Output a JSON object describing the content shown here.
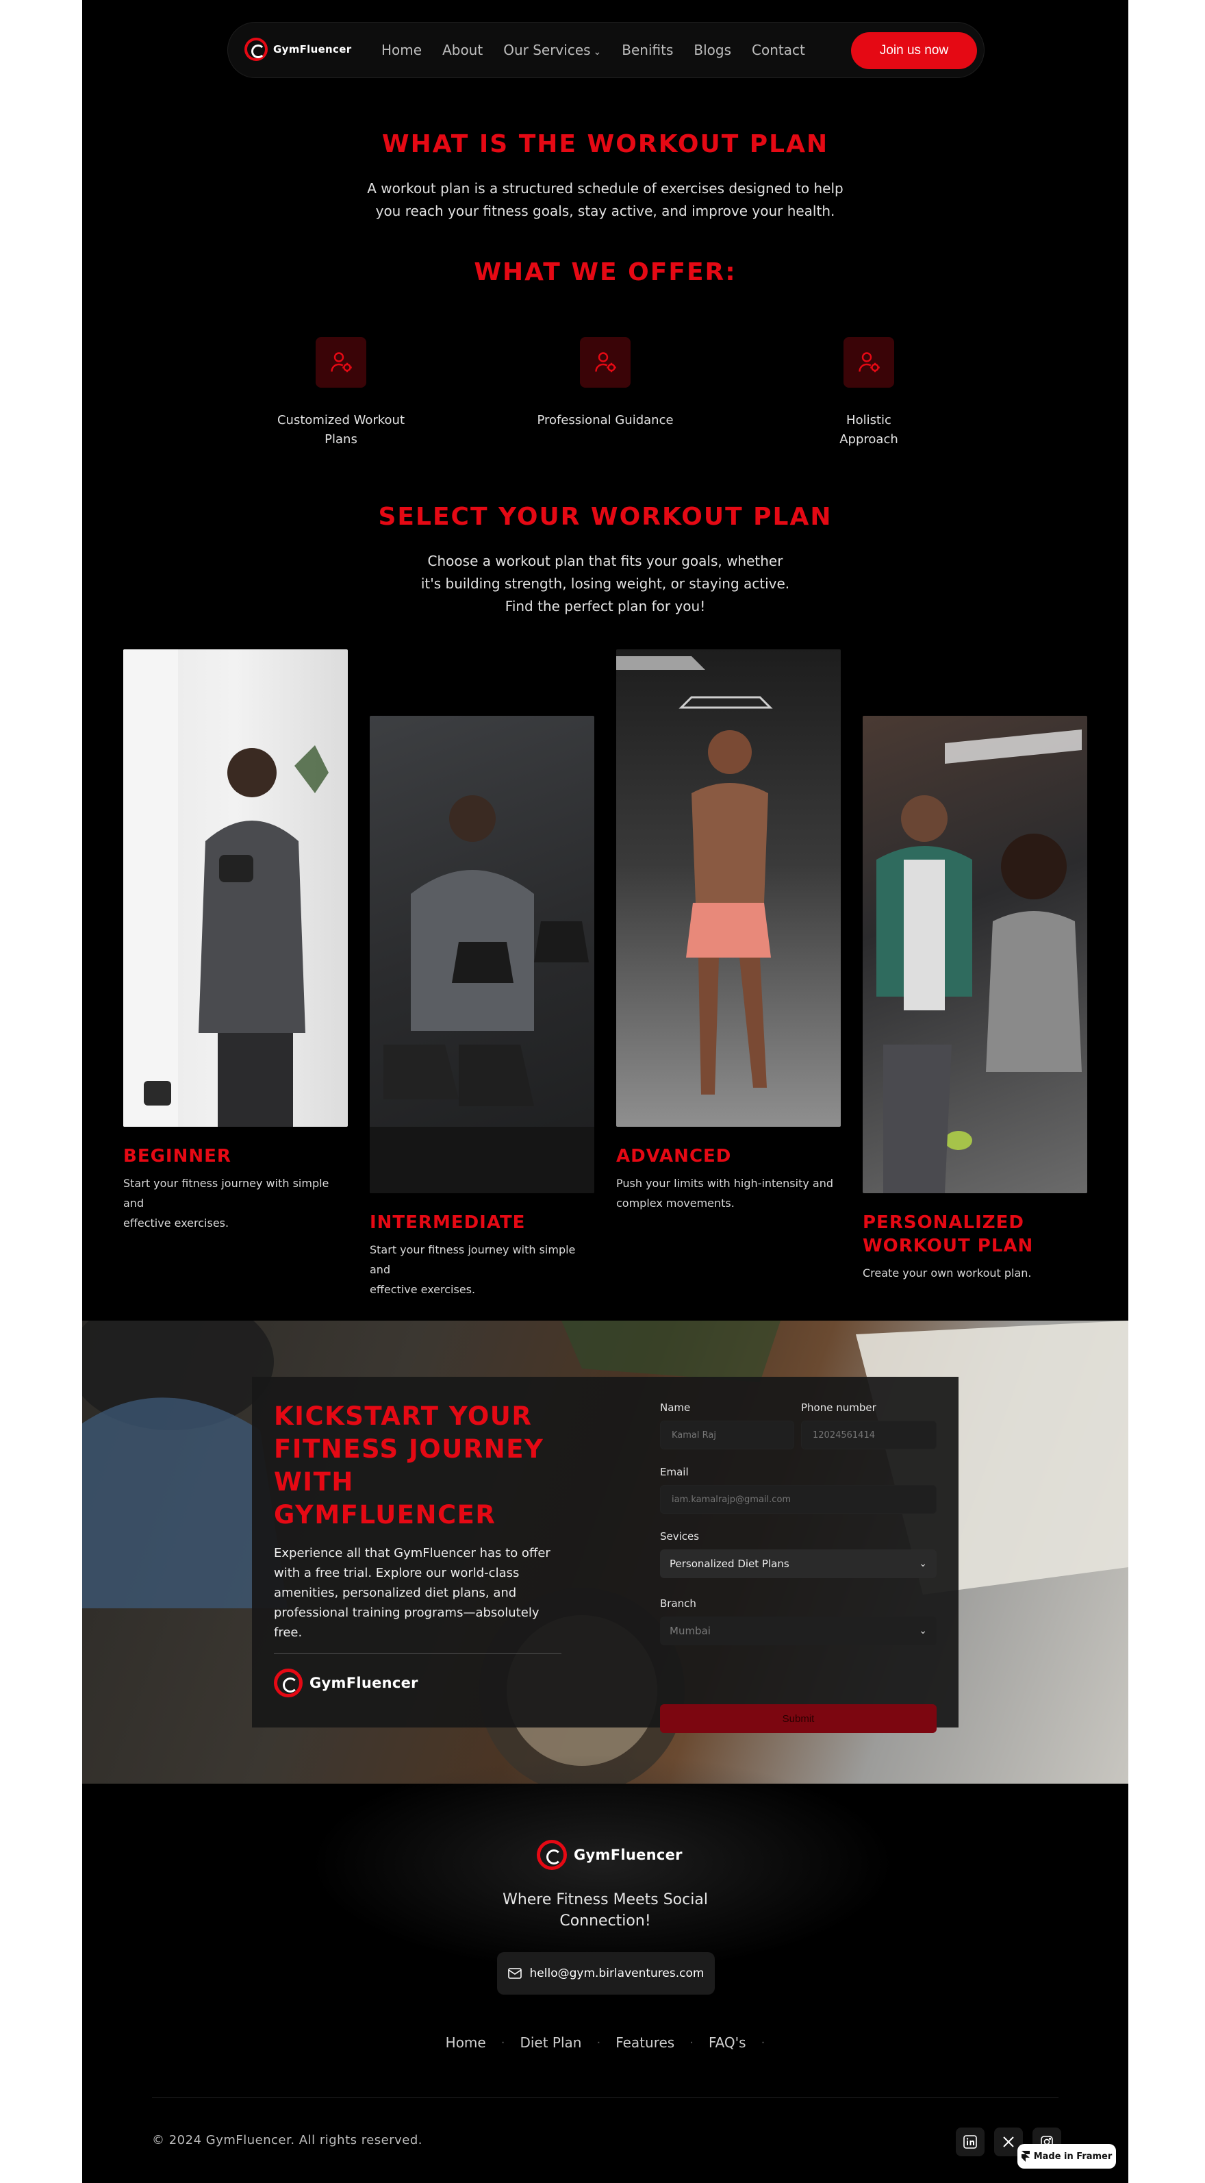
{
  "nav": {
    "brand": "GymFluencer",
    "links": [
      "Home",
      "About",
      "Our Services",
      "Benifits",
      "Blogs",
      "Contact"
    ],
    "join_label": "Join us now"
  },
  "workout": {
    "title": "WHAT IS THE WORKOUT PLAN",
    "description_line1": "A workout plan is a structured schedule of exercises designed to help",
    "description_line2": "you reach your fitness goals, stay active, and improve your health."
  },
  "offer": {
    "title": "WHAT WE OFFER:",
    "items": [
      {
        "label_line1": "Customized Workout",
        "label_line2": "Plans",
        "icon": "user-gear-icon"
      },
      {
        "label_line1": "Professional Guidance",
        "label_line2": "",
        "icon": "user-gear-icon"
      },
      {
        "label_line1": "Holistic",
        "label_line2": "Approach",
        "icon": "user-gear-icon"
      }
    ]
  },
  "select": {
    "title": "SELECT YOUR WORKOUT PLAN",
    "line1": "Choose a workout plan that fits your goals, whether",
    "line2": "it's building strength, losing weight, or staying active.",
    "line3": "Find the perfect plan for you!"
  },
  "plans": [
    {
      "title_line1": "BEGINNER",
      "title_line2": "",
      "desc_line1": "Start your fitness journey with simple and",
      "desc_line2": "effective exercises."
    },
    {
      "title_line1": "INTERMEDIATE",
      "title_line2": "",
      "desc_line1": "Start your fitness journey with simple and",
      "desc_line2": "effective exercises."
    },
    {
      "title_line1": "ADVANCED",
      "title_line2": "",
      "desc_line1": "Push your limits with high-intensity and",
      "desc_line2": "complex movements."
    },
    {
      "title_line1": "PERSONALIZED",
      "title_line2": "WORKOUT PLAN",
      "desc_line1": "Create your own workout plan.",
      "desc_line2": ""
    }
  ],
  "kickstart": {
    "title_line1": "KICKSTART YOUR",
    "title_line2": "FITNESS JOURNEY",
    "title_line3": "WITH",
    "title_line4": "GYMFLUENCER",
    "text_line1": "Experience all that GymFluencer has to offer",
    "text_line2": "with a free trial. Explore our world-class",
    "text_line3": "amenities, personalized diet plans, and",
    "text_line4": "professional training programs—absolutely",
    "text_line5": "free.",
    "brand": "GymFluencer"
  },
  "form": {
    "name_label": "Name",
    "name_placeholder": "Kamal Raj",
    "phone_label": "Phone number",
    "phone_placeholder": "12024561414",
    "email_label": "Email",
    "email_placeholder": "iam.kamalrajp@gmail.com",
    "services_label": "Sevices",
    "services_value": "Personalized Diet Plans",
    "branch_label": "Branch",
    "branch_value": "Mumbai",
    "submit_label": "Submit"
  },
  "footer": {
    "brand": "GymFluencer",
    "tagline_line1": "Where Fitness Meets Social",
    "tagline_line2": "Connection!",
    "email": "hello@gym.birlaventures.com",
    "links": [
      "Home",
      "Diet Plan",
      "Features",
      "FAQ's"
    ],
    "copyright": "© 2024 GymFluencer. All rights reserved.",
    "socials": [
      "linkedin-icon",
      "x-icon",
      "instagram-icon"
    ]
  },
  "badge": {
    "label": "Made in Framer"
  },
  "colors": {
    "accent": "#e50914",
    "background": "#000000"
  }
}
